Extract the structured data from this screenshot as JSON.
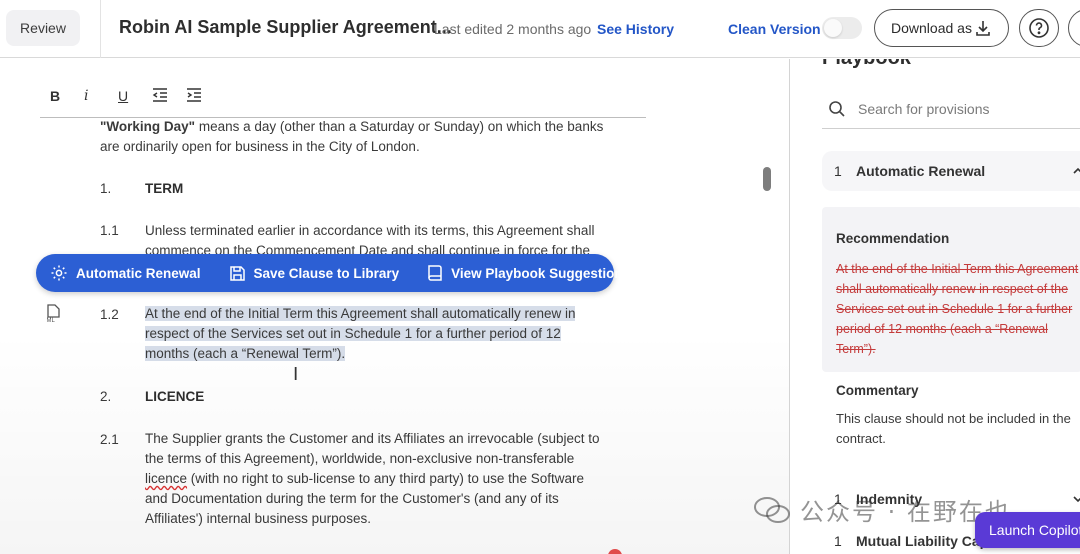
{
  "header": {
    "review_label": "Review",
    "doc_title": "Robin AI Sample Supplier Agreement...",
    "last_edited": "Last edited 2 months ago",
    "see_history": "See History",
    "clean_version": "Clean Version",
    "download_label": "Download as"
  },
  "format_toolbar": {
    "bold": "B",
    "italic": "i",
    "underline": "U"
  },
  "document": {
    "working_day_term": "\"Working Day\"",
    "working_day_def_line1": " means a day (other than a Saturday or Sunday) on which the banks",
    "working_day_def_line2": "are ordinarily open for business in the City of London.",
    "s1_num": "1.",
    "s1_title": "TERM",
    "s1_1_num": "1.1",
    "s1_1_line1": "Unless terminated earlier in accordance with its terms, this Agreement shall",
    "s1_1_line2": "commence on the Commencement Date and shall continue in force for the",
    "s1_2_num": "1.2",
    "s1_2_line1": "At the end of the Initial Term this Agreement shall automatically renew in",
    "s1_2_line2": "respect of the Services set out in Schedule 1 for a further period of 12",
    "s1_2_line3": "months (each a “Renewal Term”).",
    "s2_num": "2.",
    "s2_title": "LICENCE",
    "s2_1_num": "2.1",
    "s2_1_line1": "The Supplier grants the Customer and its Affiliates an irrevocable (subject to",
    "s2_1_line2": "the terms of this Agreement), worldwide, non-exclusive non-transferable",
    "s2_1_line3_word": "licence",
    "s2_1_line3_rest": " (with no right to sub-license to any third party) to use the Software",
    "s2_1_line4": "and Documentation during the term for the Customer's (and any of its",
    "s2_1_line5": "Affiliates') internal business purposes.",
    "ml_badge": "ML"
  },
  "action_bar": {
    "automatic_renewal": "Automatic Renewal",
    "save_clause": "Save Clause to Library",
    "view_playbook": "View Playbook Suggestion"
  },
  "sidebar": {
    "title": "Playbook",
    "search_placeholder": "Search for provisions",
    "provisions": [
      {
        "num": "1",
        "label": "Automatic Renewal"
      },
      {
        "num": "1",
        "label": "Indemnity"
      },
      {
        "num": "1",
        "label": "Mutual Liability Cap"
      }
    ],
    "recommendation_label": "Recommendation",
    "recommendation_text": "At the end of the Initial Term this Agreement shall automatically renew in respect of the Services set out in Schedule 1 for a further period of 12 months (each a “Renewal Term”).",
    "commentary_label": "Commentary",
    "commentary_text": "This clause should not be included in the contract."
  },
  "overlay": {
    "watermark": "公众号 · 在野在也",
    "launch_copilot": "Launch Copilot"
  },
  "colors": {
    "accent_blue": "#2c5fd4",
    "link_blue": "#2356c7",
    "strike_red": "#c43b3b",
    "copilot_purple": "#5a3ad6"
  }
}
